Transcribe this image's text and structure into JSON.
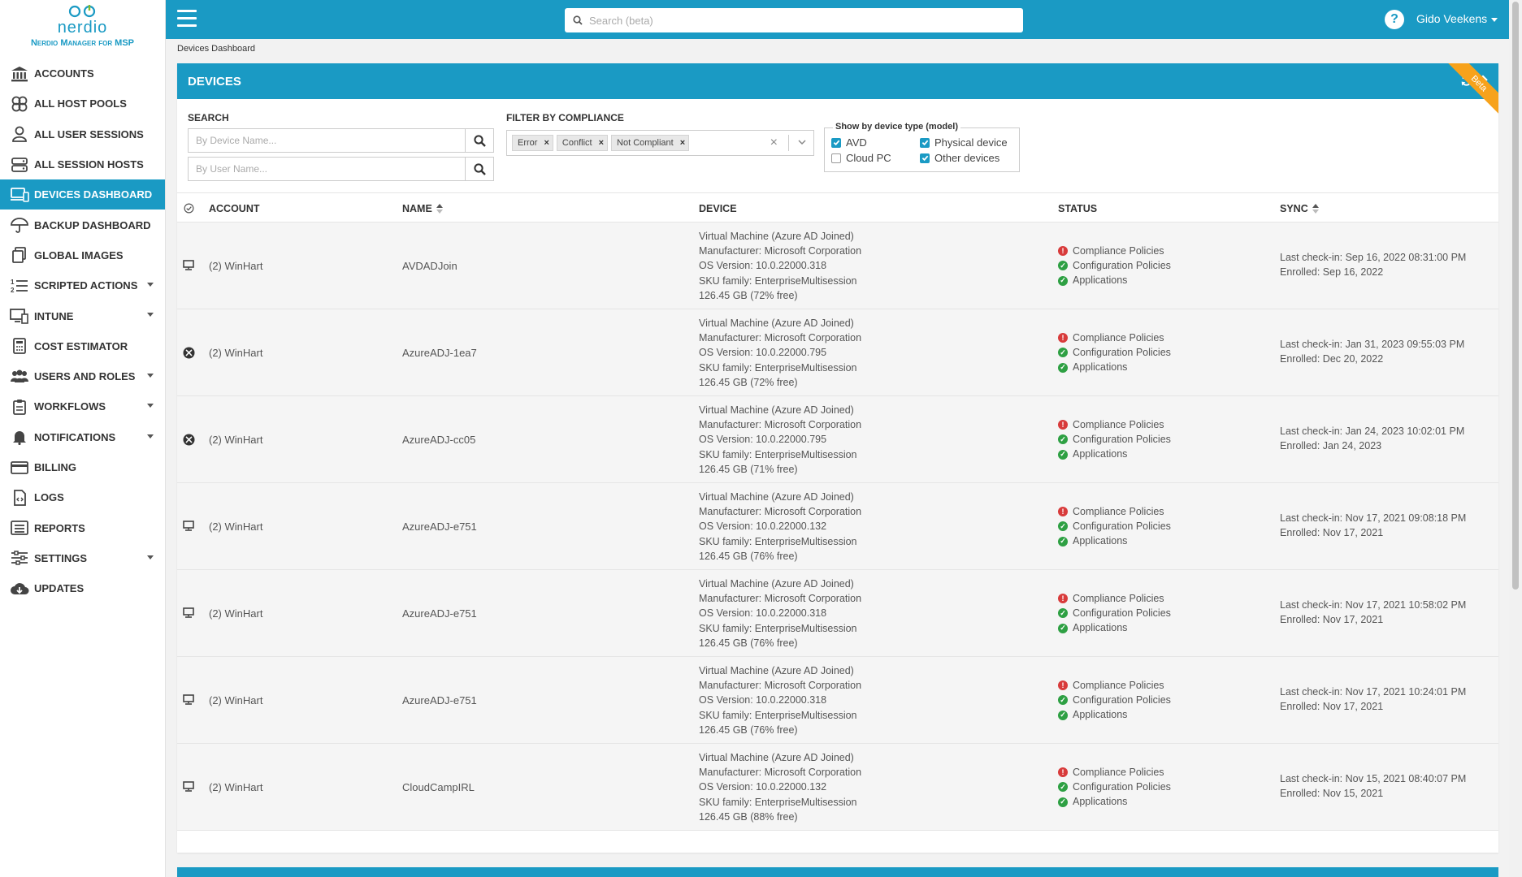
{
  "brand": {
    "name": "nerdio",
    "subtitle": "Nerdio Manager for MSP",
    "accent": "#1a9ac4"
  },
  "sidebar": {
    "items": [
      {
        "label": "ACCOUNTS",
        "icon": "bank-icon",
        "caret": false,
        "active": false
      },
      {
        "label": "ALL HOST POOLS",
        "icon": "host-pools-icon",
        "caret": false,
        "active": false
      },
      {
        "label": "ALL USER SESSIONS",
        "icon": "user-icon",
        "caret": false,
        "active": false
      },
      {
        "label": "ALL SESSION HOSTS",
        "icon": "server-icon",
        "caret": false,
        "active": false
      },
      {
        "label": "DEVICES DASHBOARD",
        "icon": "devices-icon",
        "caret": false,
        "active": true
      },
      {
        "label": "BACKUP DASHBOARD",
        "icon": "umbrella-icon",
        "caret": false,
        "active": false
      },
      {
        "label": "GLOBAL IMAGES",
        "icon": "images-icon",
        "caret": false,
        "active": false
      },
      {
        "label": "SCRIPTED ACTIONS",
        "icon": "list-icon",
        "caret": true,
        "active": false
      },
      {
        "label": "INTUNE",
        "icon": "intune-icon",
        "caret": true,
        "active": false
      },
      {
        "label": "COST ESTIMATOR",
        "icon": "calculator-icon",
        "caret": false,
        "active": false
      },
      {
        "label": "USERS AND ROLES",
        "icon": "users-icon",
        "caret": true,
        "active": false
      },
      {
        "label": "WORKFLOWS",
        "icon": "clipboard-icon",
        "caret": true,
        "active": false
      },
      {
        "label": "NOTIFICATIONS",
        "icon": "bell-icon",
        "caret": true,
        "active": false
      },
      {
        "label": "BILLING",
        "icon": "billing-icon",
        "caret": false,
        "active": false
      },
      {
        "label": "LOGS",
        "icon": "logs-icon",
        "caret": false,
        "active": false
      },
      {
        "label": "REPORTS",
        "icon": "reports-icon",
        "caret": false,
        "active": false
      },
      {
        "label": "SETTINGS",
        "icon": "sliders-icon",
        "caret": true,
        "active": false
      },
      {
        "label": "UPDATES",
        "icon": "cloud-download-icon",
        "caret": false,
        "active": false
      }
    ]
  },
  "topbar": {
    "search_placeholder": "Search (beta)",
    "user_name": "Gido Veekens",
    "help": "?"
  },
  "breadcrumb": "Devices Dashboard",
  "panel": {
    "title": "DEVICES",
    "beta": "Beta",
    "filters": {
      "search_label": "SEARCH",
      "device_placeholder": "By Device Name...",
      "user_placeholder": "By User Name...",
      "compliance_label": "FILTER BY COMPLIANCE",
      "compliance_chips": [
        "Error",
        "Conflict",
        "Not Compliant"
      ],
      "device_type_legend": "Show by device type (model)",
      "device_types": [
        {
          "label": "AVD",
          "checked": true
        },
        {
          "label": "Physical device",
          "checked": true
        },
        {
          "label": "Cloud PC",
          "checked": false
        },
        {
          "label": "Other devices",
          "checked": true
        }
      ]
    },
    "columns": {
      "account": "ACCOUNT",
      "name": "NAME",
      "device": "DEVICE",
      "status": "STATUS",
      "sync": "SYNC"
    },
    "rows": [
      {
        "icon": "monitor-icon",
        "account": "(2) WinHart",
        "name": "AVDADJoin",
        "device": [
          "Virtual Machine (Azure AD Joined)",
          "Manufacturer: Microsoft Corporation",
          "OS Version: 10.0.22000.318",
          "SKU family: EnterpriseMultisession",
          "126.45 GB (72% free)"
        ],
        "status": [
          {
            "label": "Compliance Policies",
            "state": "error"
          },
          {
            "label": "Configuration Policies",
            "state": "ok"
          },
          {
            "label": "Applications",
            "state": "ok"
          }
        ],
        "sync": [
          "Last check-in: Sep 16, 2022 08:31:00 PM",
          "Enrolled: Sep 16, 2022"
        ]
      },
      {
        "icon": "xbox-icon",
        "account": "(2) WinHart",
        "name": "AzureADJ-1ea7",
        "device": [
          "Virtual Machine (Azure AD Joined)",
          "Manufacturer: Microsoft Corporation",
          "OS Version: 10.0.22000.795",
          "SKU family: EnterpriseMultisession",
          "126.45 GB (72% free)"
        ],
        "status": [
          {
            "label": "Compliance Policies",
            "state": "error"
          },
          {
            "label": "Configuration Policies",
            "state": "ok"
          },
          {
            "label": "Applications",
            "state": "ok"
          }
        ],
        "sync": [
          "Last check-in: Jan 31, 2023 09:55:03 PM",
          "Enrolled: Dec 20, 2022"
        ]
      },
      {
        "icon": "xbox-icon",
        "account": "(2) WinHart",
        "name": "AzureADJ-cc05",
        "device": [
          "Virtual Machine (Azure AD Joined)",
          "Manufacturer: Microsoft Corporation",
          "OS Version: 10.0.22000.795",
          "SKU family: EnterpriseMultisession",
          "126.45 GB (71% free)"
        ],
        "status": [
          {
            "label": "Compliance Policies",
            "state": "error"
          },
          {
            "label": "Configuration Policies",
            "state": "ok"
          },
          {
            "label": "Applications",
            "state": "ok"
          }
        ],
        "sync": [
          "Last check-in: Jan 24, 2023 10:02:01 PM",
          "Enrolled: Jan 24, 2023"
        ]
      },
      {
        "icon": "monitor-icon",
        "account": "(2) WinHart",
        "name": "AzureADJ-e751",
        "device": [
          "Virtual Machine (Azure AD Joined)",
          "Manufacturer: Microsoft Corporation",
          "OS Version: 10.0.22000.132",
          "SKU family: EnterpriseMultisession",
          "126.45 GB (76% free)"
        ],
        "status": [
          {
            "label": "Compliance Policies",
            "state": "error"
          },
          {
            "label": "Configuration Policies",
            "state": "ok"
          },
          {
            "label": "Applications",
            "state": "ok"
          }
        ],
        "sync": [
          "Last check-in: Nov 17, 2021 09:08:18 PM",
          "Enrolled: Nov 17, 2021"
        ]
      },
      {
        "icon": "monitor-icon",
        "account": "(2) WinHart",
        "name": "AzureADJ-e751",
        "device": [
          "Virtual Machine (Azure AD Joined)",
          "Manufacturer: Microsoft Corporation",
          "OS Version: 10.0.22000.318",
          "SKU family: EnterpriseMultisession",
          "126.45 GB (76% free)"
        ],
        "status": [
          {
            "label": "Compliance Policies",
            "state": "error"
          },
          {
            "label": "Configuration Policies",
            "state": "ok"
          },
          {
            "label": "Applications",
            "state": "ok"
          }
        ],
        "sync": [
          "Last check-in: Nov 17, 2021 10:58:02 PM",
          "Enrolled: Nov 17, 2021"
        ]
      },
      {
        "icon": "monitor-icon",
        "account": "(2) WinHart",
        "name": "AzureADJ-e751",
        "device": [
          "Virtual Machine (Azure AD Joined)",
          "Manufacturer: Microsoft Corporation",
          "OS Version: 10.0.22000.318",
          "SKU family: EnterpriseMultisession",
          "126.45 GB (76% free)"
        ],
        "status": [
          {
            "label": "Compliance Policies",
            "state": "error"
          },
          {
            "label": "Configuration Policies",
            "state": "ok"
          },
          {
            "label": "Applications",
            "state": "ok"
          }
        ],
        "sync": [
          "Last check-in: Nov 17, 2021 10:24:01 PM",
          "Enrolled: Nov 17, 2021"
        ]
      },
      {
        "icon": "monitor-icon",
        "account": "(2) WinHart",
        "name": "CloudCampIRL",
        "device": [
          "Virtual Machine (Azure AD Joined)",
          "Manufacturer: Microsoft Corporation",
          "OS Version: 10.0.22000.132",
          "SKU family: EnterpriseMultisession",
          "126.45 GB (88% free)"
        ],
        "status": [
          {
            "label": "Compliance Policies",
            "state": "error"
          },
          {
            "label": "Configuration Policies",
            "state": "ok"
          },
          {
            "label": "Applications",
            "state": "ok"
          }
        ],
        "sync": [
          "Last check-in: Nov 15, 2021 08:40:07 PM",
          "Enrolled: Nov 15, 2021"
        ]
      }
    ]
  }
}
